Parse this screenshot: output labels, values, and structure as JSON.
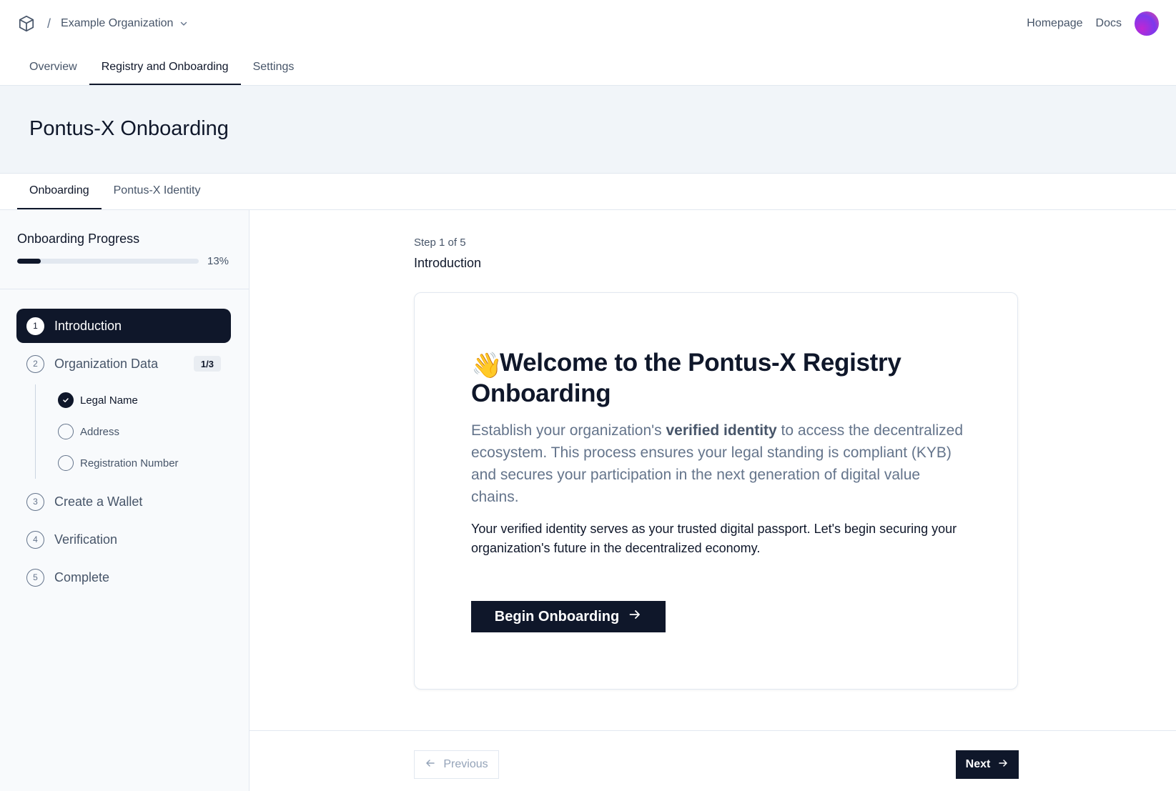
{
  "header": {
    "brand_icon": "cube-icon",
    "breadcrumb_separator": "/",
    "organization": "Example Organization",
    "links": {
      "homepage": "Homepage",
      "docs": "Docs"
    }
  },
  "main_tabs": [
    {
      "label": "Overview",
      "active": false
    },
    {
      "label": "Registry and Onboarding",
      "active": true
    },
    {
      "label": "Settings",
      "active": false
    }
  ],
  "page_title": "Pontus-X Onboarding",
  "sub_tabs": [
    {
      "label": "Onboarding",
      "active": true
    },
    {
      "label": "Pontus-X Identity",
      "active": false
    }
  ],
  "sidebar": {
    "progress_title": "Onboarding Progress",
    "progress_percent": 13,
    "progress_label": "13%",
    "steps": [
      {
        "number": "1",
        "label": "Introduction",
        "active": true
      },
      {
        "number": "2",
        "label": "Organization Data",
        "badge": "1/3",
        "substeps": [
          {
            "label": "Legal Name",
            "done": true
          },
          {
            "label": "Address",
            "done": false
          },
          {
            "label": "Registration Number",
            "done": false
          }
        ]
      },
      {
        "number": "3",
        "label": "Create a Wallet"
      },
      {
        "number": "4",
        "label": "Verification"
      },
      {
        "number": "5",
        "label": "Complete"
      }
    ]
  },
  "content": {
    "step_counter": "Step 1 of 5",
    "step_name": "Introduction",
    "card": {
      "emoji": "👋",
      "title": "Welcome to the Pontus-X Registry Onboarding",
      "lead_before": "Establish your organization's ",
      "lead_bold": "verified identity",
      "lead_after": " to access the decentralized ecosystem. This process ensures your legal standing is compliant (KYB) and secures your participation in the next generation of digital value chains.",
      "body": "Your verified identity serves as your trusted digital passport. Let's begin securing your organization's future in the decentralized economy.",
      "cta_label": "Begin Onboarding"
    }
  },
  "footer": {
    "previous_label": "Previous",
    "next_label": "Next"
  },
  "colors": {
    "primary": "#0f172a",
    "muted_text": "#475569",
    "panel_bg": "#f1f5f9",
    "border": "#e2e8f0"
  }
}
